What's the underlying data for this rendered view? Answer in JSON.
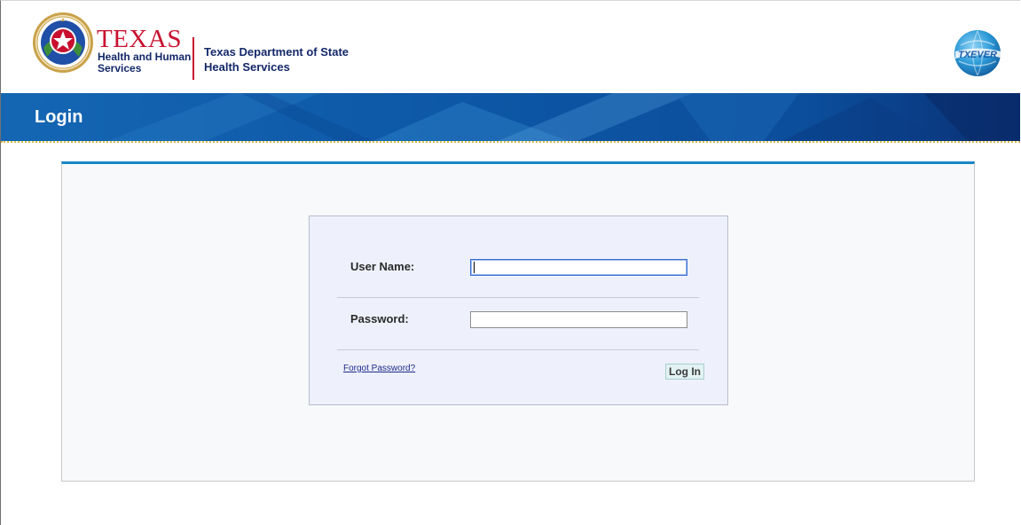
{
  "header": {
    "hhs_logo": {
      "word_texas": "TEXAS",
      "line1": "Health and Human",
      "line2": "Services"
    },
    "dshs": {
      "line1": "Texas Department of State",
      "line2": "Health Services"
    },
    "txever_logo": {
      "text": "TXEVER",
      "icon": "txever-globe-logo"
    }
  },
  "banner": {
    "title": "Login"
  },
  "login_form": {
    "user_name_label": "User Name:",
    "user_name_value": "",
    "password_label": "Password:",
    "password_value": "",
    "forgot_password_link": "Forgot Password?",
    "login_button": "Log In"
  },
  "colors": {
    "banner_blue": "#0a4fa0",
    "panel_accent": "#1a86c6",
    "texas_red": "#c8102e",
    "navy_text": "#14286a",
    "dotted_rule": "#d9b94a"
  }
}
